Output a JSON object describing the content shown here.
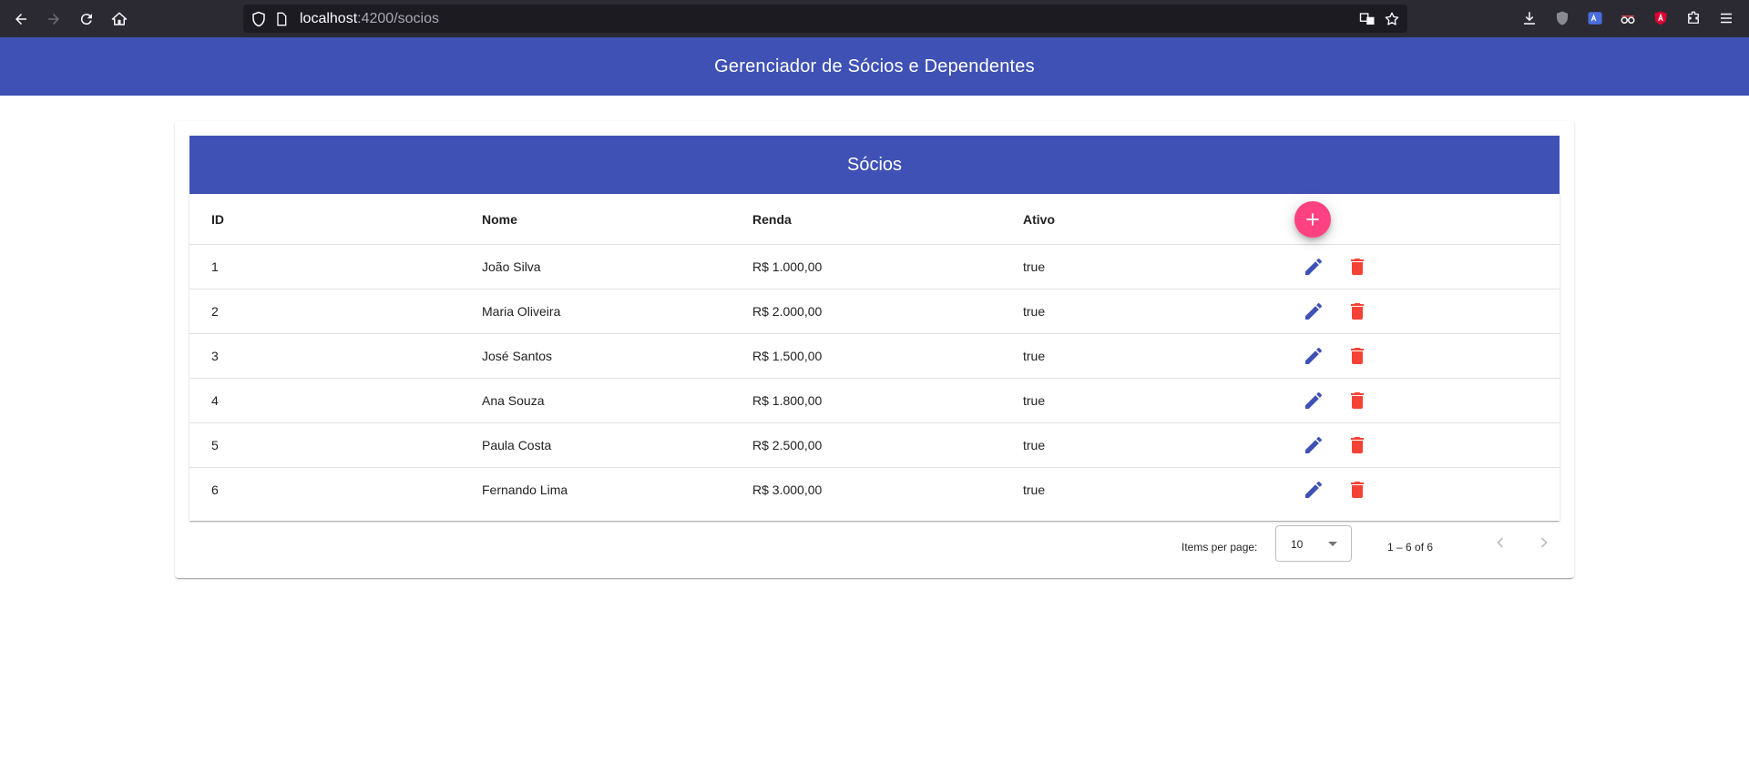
{
  "browser": {
    "url_host": "localhost",
    "url_rest": ":4200/socios"
  },
  "app": {
    "title": "Gerenciador de Sócios e Dependentes"
  },
  "card": {
    "title": "Sócios"
  },
  "table": {
    "columns": [
      "ID",
      "Nome",
      "Renda",
      "Ativo"
    ],
    "rows": [
      {
        "id": "1",
        "nome": "João Silva",
        "renda": "R$ 1.000,00",
        "ativo": "true"
      },
      {
        "id": "2",
        "nome": "Maria Oliveira",
        "renda": "R$ 2.000,00",
        "ativo": "true"
      },
      {
        "id": "3",
        "nome": "José Santos",
        "renda": "R$ 1.500,00",
        "ativo": "true"
      },
      {
        "id": "4",
        "nome": "Ana Souza",
        "renda": "R$ 1.800,00",
        "ativo": "true"
      },
      {
        "id": "5",
        "nome": "Paula Costa",
        "renda": "R$ 2.500,00",
        "ativo": "true"
      },
      {
        "id": "6",
        "nome": "Fernando Lima",
        "renda": "R$ 3.000,00",
        "ativo": "true"
      }
    ]
  },
  "paginator": {
    "items_per_page_label": "Items per page:",
    "page_size": "10",
    "range_label": "1 – 6 of 6"
  },
  "colors": {
    "primary": "#3f51b5",
    "accent": "#ff4081",
    "warn": "#f44336"
  }
}
